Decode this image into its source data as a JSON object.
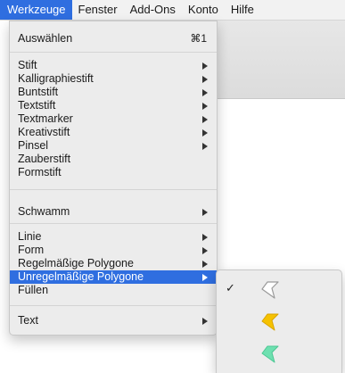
{
  "menubar": {
    "items": [
      {
        "label": "Werkzeuge",
        "active": true
      },
      {
        "label": "Fenster"
      },
      {
        "label": "Add-Ons"
      },
      {
        "label": "Konto"
      },
      {
        "label": "Hilfe"
      }
    ]
  },
  "dropdown": {
    "items": [
      {
        "label": "Auswählen",
        "shortcut": "⌘1"
      },
      {
        "label": "Stift",
        "submenu": true
      },
      {
        "label": "Kalligraphiestift",
        "submenu": true
      },
      {
        "label": "Buntstift",
        "submenu": true
      },
      {
        "label": "Textstift",
        "submenu": true
      },
      {
        "label": "Textmarker",
        "submenu": true
      },
      {
        "label": "Kreativstift",
        "submenu": true
      },
      {
        "label": "Pinsel",
        "submenu": true
      },
      {
        "label": "Zauberstift"
      },
      {
        "label": "Formstift"
      },
      {
        "label": "Schwamm",
        "submenu": true
      },
      {
        "label": "Linie",
        "submenu": true
      },
      {
        "label": "Form",
        "submenu": true
      },
      {
        "label": "Regelmäßige Polygone",
        "submenu": true
      },
      {
        "label": "Unregelmäßige Polygone",
        "submenu": true,
        "highlighted": true
      },
      {
        "label": "Füllen"
      },
      {
        "label": "Text",
        "submenu": true
      }
    ]
  },
  "submenu": {
    "check_mark": "✓",
    "items": [
      {
        "icon": "polygon-outline-icon",
        "checked": true,
        "fill": "#ffffff",
        "stroke": "#9a9a9a"
      },
      {
        "icon": "polygon-yellow-icon",
        "checked": false,
        "fill": "#f6c200",
        "stroke": "#d8a400"
      },
      {
        "icon": "polygon-green-icon",
        "checked": false,
        "fill": "#6ee0b0",
        "stroke": "#4cc793"
      }
    ]
  },
  "colors": {
    "highlight": "#2f6ee0",
    "menu_bg": "#ececec"
  }
}
